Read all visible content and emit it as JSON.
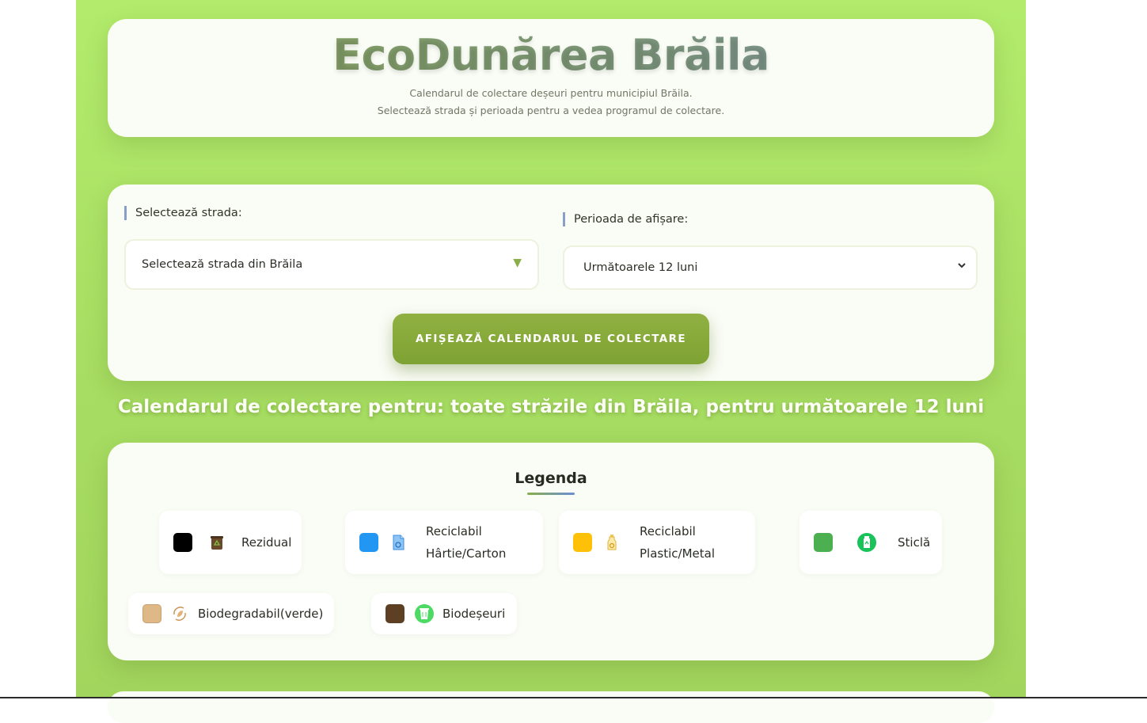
{
  "header": {
    "title": "EcoDunărea Brăila",
    "description_line1": "Calendarul de colectare deșeuri pentru municipiul Brăila.",
    "description_line2": "Selectează strada și perioada pentru a vedea programul de colectare."
  },
  "filters": {
    "street_label": "Selectează strada:",
    "street_value": "Selectează strada din Brăila",
    "period_label": "Perioada de afișare:",
    "period_value": "Următoarele 12 luni",
    "submit_label": "AFIȘEAZĂ CALENDARUL DE COLECTARE"
  },
  "result_title": "Calendarul de colectare pentru: toate străzile din Brăila, pentru următoarele 12 luni",
  "legend": {
    "title": "Legenda",
    "items": [
      {
        "line1": "Rezidual",
        "line2": "",
        "color": "#000000",
        "icon": "residual-bin-icon"
      },
      {
        "line1": "Reciclabil",
        "line2": "Hârtie/Carton",
        "color": "#2196f3",
        "icon": "paper-recycle-icon"
      },
      {
        "line1": "Reciclabil",
        "line2": "Plastic/Metal",
        "color": "#ffc107",
        "icon": "plastic-bottle-icon"
      },
      {
        "line1": "Sticlă",
        "line2": "",
        "color": "#4caf50",
        "icon": "glass-recycle-icon"
      },
      {
        "line1": "Biodegradabil(verde)",
        "line2": "",
        "color": "#deb887",
        "icon": "leaf-cycle-icon"
      },
      {
        "line1": "Biodeșeuri",
        "line2": "",
        "color": "#5d4023",
        "icon": "bio-bin-icon"
      }
    ]
  }
}
